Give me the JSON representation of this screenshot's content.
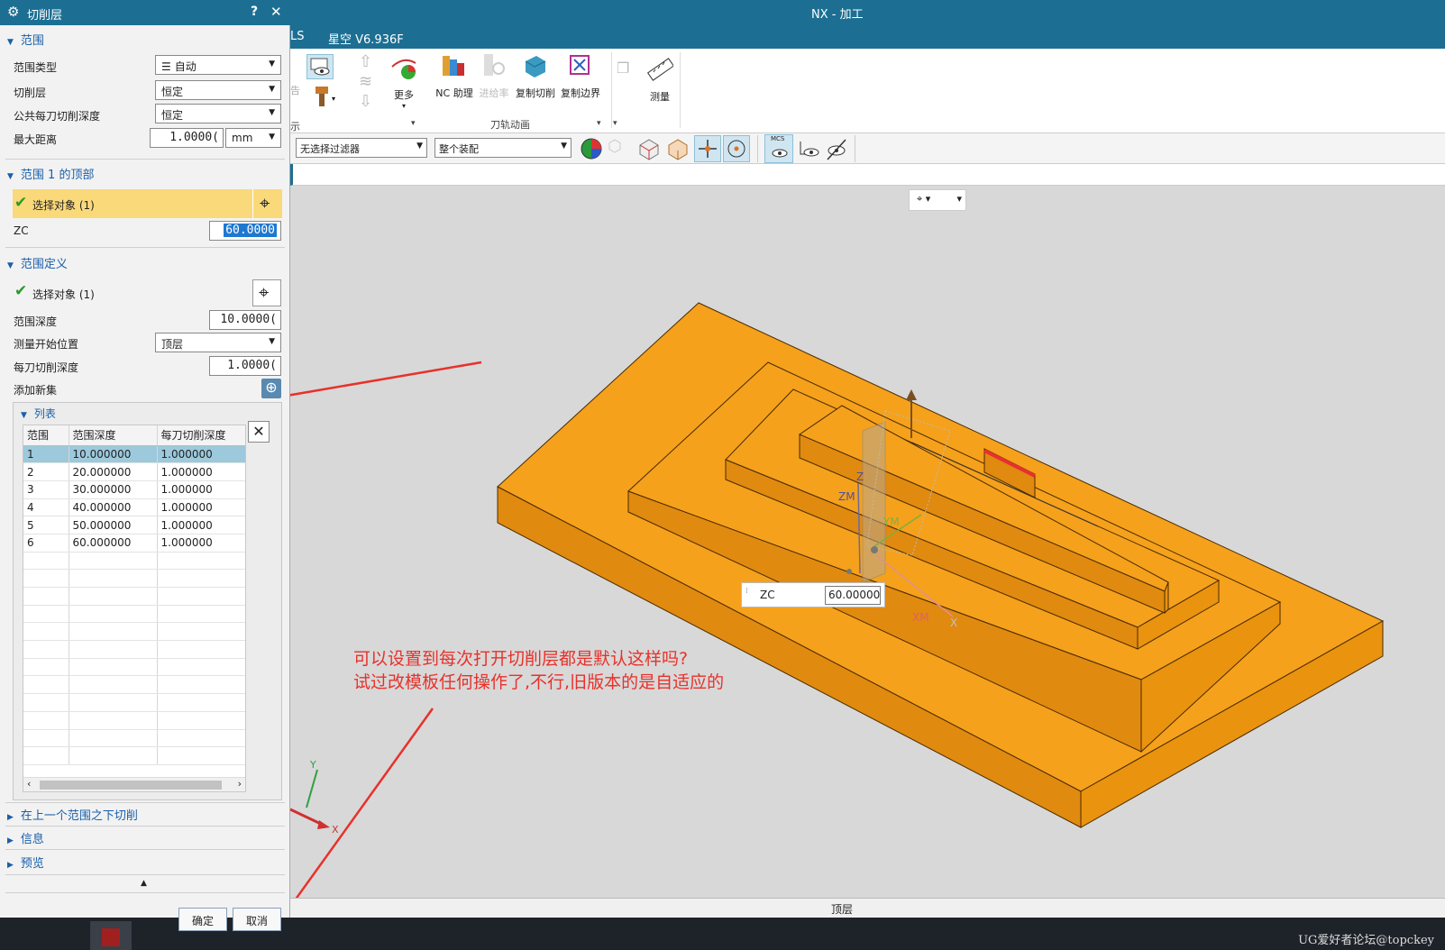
{
  "app": {
    "title": "NX - 加工"
  },
  "menu": {
    "items": [
      "LS",
      "星空 V6.936F"
    ]
  },
  "ribbon": {
    "more_label": "更多",
    "nc_helper": "NC 助理",
    "feed_rate": "进给率",
    "copy_cut": "复制切削",
    "copy_boundary": "复制边界",
    "group_label": "刀轨动画",
    "measure": "测量",
    "left_partial": "告",
    "left_group_partial": "示"
  },
  "filterbar": {
    "filter": "无选择过滤器",
    "assembly": "整个装配",
    "mcs_label": "MCS"
  },
  "dialog": {
    "title": "切削层",
    "help": "?",
    "close": "✕",
    "range_section": "范围",
    "range_type_label": "范围类型",
    "range_type_value": "自动",
    "cut_level_label": "切削层",
    "cut_level_value": "恒定",
    "common_depth_label": "公共每刀切削深度",
    "common_depth_value": "恒定",
    "max_distance_label": "最大距离",
    "max_distance_value": "1.0000(",
    "unit": "mm",
    "top_section": "范围 1 的顶部",
    "select_object": "选择对象 (1)",
    "zc_label": "ZC",
    "zc_value": "60.0000",
    "def_section": "范围定义",
    "select_object2": "选择对象 (1)",
    "range_depth_label": "范围深度",
    "range_depth_value": "10.0000(",
    "measure_from_label": "测量开始位置",
    "measure_from_value": "顶层",
    "per_cut_label": "每刀切削深度",
    "per_cut_value": "1.0000(",
    "add_set_label": "添加新集",
    "list_section": "列表",
    "table": {
      "headers": [
        "范围",
        "范围深度",
        "每刀切削深度"
      ],
      "rows": [
        [
          "1",
          "10.000000",
          "1.000000"
        ],
        [
          "2",
          "20.000000",
          "1.000000"
        ],
        [
          "3",
          "30.000000",
          "1.000000"
        ],
        [
          "4",
          "40.000000",
          "1.000000"
        ],
        [
          "5",
          "50.000000",
          "1.000000"
        ],
        [
          "6",
          "60.000000",
          "1.000000"
        ]
      ]
    },
    "below_section": "在上一个范围之下切削",
    "info_section": "信息",
    "preview_section": "预览",
    "ok": "确定",
    "cancel": "取消"
  },
  "viewport": {
    "zc_label": "ZC",
    "zc_value": "60.000000",
    "axis_labels": {
      "z": "Z",
      "zm": "ZM",
      "ym": "YM",
      "xm": "XM",
      "x": "X",
      "y": "Y"
    }
  },
  "annotation": {
    "line1": "可以设置到每次打开切削层都是默认这样吗?",
    "line2": "试过改模板任何操作了,不行,旧版本的是自适应的"
  },
  "status": {
    "text": "顶层"
  },
  "watermark": "UG爱好者论坛@topckey",
  "colors": {
    "accent": "#1c6f93",
    "part": "#f5a11c",
    "arrow": "#e8312a",
    "selected_row": "#9cc9dc"
  }
}
